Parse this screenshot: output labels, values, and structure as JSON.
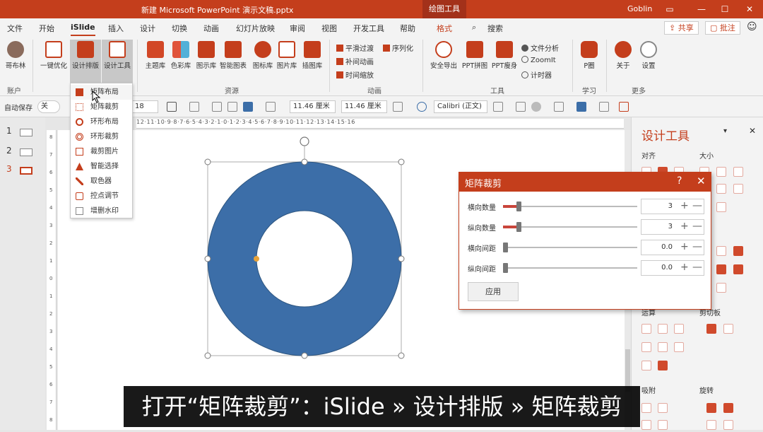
{
  "window": {
    "title": "新建 Microsoft PowerPoint 演示文稿.pptx",
    "context_tab_group": "绘图工具",
    "user": "Goblin",
    "minimize": "—",
    "restore": "❐",
    "maximize": "☐",
    "close": "✕"
  },
  "tabs": [
    "文件",
    "开始",
    "iSlide",
    "插入",
    "设计",
    "切换",
    "动画",
    "幻灯片放映",
    "审阅",
    "视图",
    "开发工具",
    "帮助",
    "格式"
  ],
  "search": "搜索",
  "share": "共享",
  "comment": "批注",
  "ribbon": {
    "account": {
      "label": "哥布林",
      "group": "账户"
    },
    "buttons": [
      {
        "label": "一键优化"
      },
      {
        "label": "设计排版"
      },
      {
        "label": "设计工具"
      },
      {
        "label": "主题库"
      },
      {
        "label": "色彩库"
      },
      {
        "label": "图示库"
      },
      {
        "label": "智能图表"
      },
      {
        "label": "图标库"
      },
      {
        "label": "图片库"
      },
      {
        "label": "插图库"
      },
      {
        "label": "安全导出"
      },
      {
        "label": "PPT拼图"
      },
      {
        "label": "PPT瘦身"
      },
      {
        "label": "P圈"
      },
      {
        "label": "关于"
      },
      {
        "label": "设置"
      }
    ],
    "anim_items": [
      "平滑过渡",
      "补间动画",
      "时间缩放",
      "序列化"
    ],
    "tool_items": [
      "文件分析",
      "ZoomIt",
      "计时器"
    ],
    "groups": [
      "资源",
      "动画",
      "工具",
      "学习",
      "更多"
    ]
  },
  "format_bar": {
    "autosave_label": "自动保存",
    "autosave_state": "关",
    "font_size": "18",
    "height": "11.46 厘米",
    "width": "11.46 厘米",
    "font": "Calibri (正文)"
  },
  "slides": {
    "numbers": [
      "1",
      "2",
      "3"
    ],
    "active": "3"
  },
  "ruler": {
    "h_labels": "12·11·10·9·8·7·6·5·4·3·2·1·0·1·2·3·4·5·6·7·8·9·10·11·12·13·14·15·16",
    "v_labels": [
      "8",
      "7",
      "6",
      "5",
      "4",
      "3",
      "2",
      "1",
      "0",
      "1",
      "2",
      "3",
      "4",
      "5",
      "6",
      "7",
      "8"
    ]
  },
  "dropdown_menu": {
    "items": [
      "矩阵布局",
      "矩阵裁剪",
      "环形布局",
      "环形裁剪",
      "裁剪图片",
      "智能选择",
      "取色器",
      "控点调节",
      "增删水印"
    ],
    "hovered": "矩阵布局"
  },
  "dialog": {
    "title": "矩阵裁剪",
    "help": "?",
    "close": "✕",
    "rows": [
      {
        "label": "横向数量",
        "value": "3",
        "fraction": 0.1
      },
      {
        "label": "纵向数量",
        "value": "3",
        "fraction": 0.1
      },
      {
        "label": "横向间距",
        "value": "0.0",
        "fraction": 0.0
      },
      {
        "label": "纵向间距",
        "value": "0.0",
        "fraction": 0.0
      }
    ],
    "plus": "+",
    "minus": "—",
    "apply": "应用"
  },
  "right_panel": {
    "title": "设计工具",
    "sections": [
      "对齐",
      "大小",
      "运算",
      "剪切板",
      "吸附",
      "旋转"
    ]
  },
  "colors": {
    "accent": "#c43e1c",
    "donut": "#3c6ea8",
    "donut_stroke": "#2e5680",
    "handle_yellow": "#e8a33a"
  },
  "caption": "打开“矩阵裁剪”：iSlide » 设计排版 » 矩阵裁剪"
}
